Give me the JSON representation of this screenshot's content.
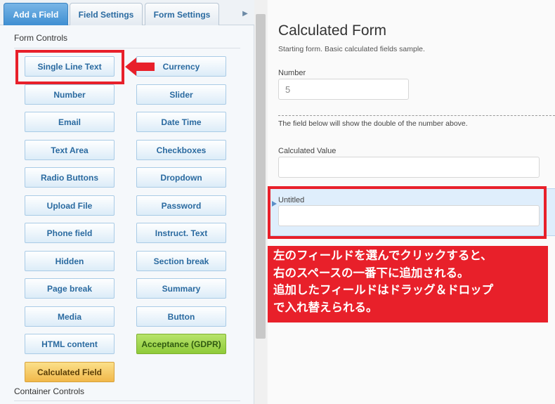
{
  "tabs": [
    {
      "label": "Add a Field",
      "active": true
    },
    {
      "label": "Field Settings",
      "active": false
    },
    {
      "label": "Form Settings",
      "active": false
    }
  ],
  "tab_scroll_icon": "chevron-right-icon",
  "sections": {
    "form_controls": "Form Controls",
    "container_controls": "Container Controls"
  },
  "controls": [
    [
      "Single Line Text",
      "Currency"
    ],
    [
      "Number",
      "Slider"
    ],
    [
      "Email",
      "Date Time"
    ],
    [
      "Text Area",
      "Checkboxes"
    ],
    [
      "Radio Buttons",
      "Dropdown"
    ],
    [
      "Upload File",
      "Password"
    ],
    [
      "Phone field",
      "Instruct. Text"
    ],
    [
      "Hidden",
      "Section break"
    ],
    [
      "Page break",
      "Summary"
    ],
    [
      "Media",
      "Button"
    ],
    [
      "HTML content",
      "Acceptance (GDPR)"
    ],
    [
      "Calculated Field"
    ]
  ],
  "form": {
    "title": "Calculated Form",
    "description": "Starting form. Basic calculated fields sample.",
    "number_label": "Number",
    "number_value": "5",
    "separator_text": "The field below will show the double of the number above.",
    "calculated_label": "Calculated Value",
    "calculated_value": "",
    "untitled_label": "Untitled",
    "untitled_value": ""
  },
  "annotation": {
    "lines": [
      "左のフィールドを選んでクリックすると、",
      "右のスペースの一番下に追加される。",
      "追加したフィールドはドラッグ＆ドロップ",
      "で入れ替えられる。"
    ]
  },
  "colors": {
    "annotation_red": "#e8202a",
    "tab_active": "#3f8fd2",
    "control_text": "#2a6aa0",
    "gdpr_green": "#8fcb3a",
    "calculated_orange": "#f1b84a"
  }
}
